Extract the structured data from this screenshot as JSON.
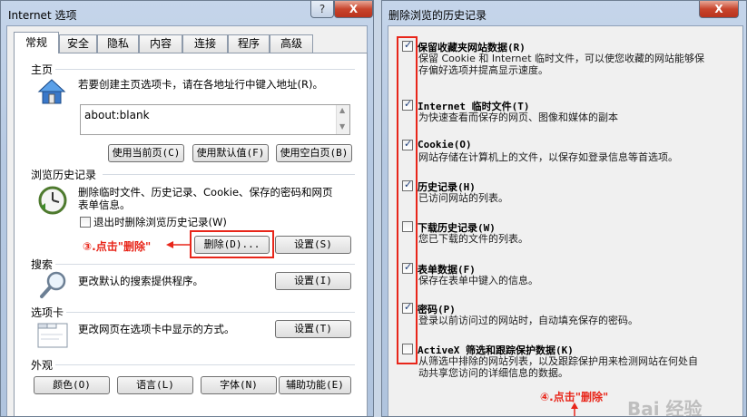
{
  "left_window": {
    "title": "Internet 选项",
    "help_btn": "?",
    "close_btn": "X",
    "tabs": [
      "常规",
      "安全",
      "隐私",
      "内容",
      "连接",
      "程序",
      "高级"
    ],
    "home": {
      "section": "主页",
      "desc": "若要创建主页选项卡，请在各地址行中键入地址(R)。",
      "url": "about:blank",
      "buttons": [
        "使用当前页(C)",
        "使用默认值(F)",
        "使用空白页(B)"
      ]
    },
    "history": {
      "section": "浏览历史记录",
      "desc_line1": "删除临时文件、历史记录、Cookie、保存的密码和网页",
      "desc_line2": "表单信息。",
      "checkbox_label": "退出时删除浏览历史记录(W)",
      "annotation": "③.点击\"删除\"",
      "delete_btn": "删除(D)...",
      "settings_btn": "设置(S)"
    },
    "search": {
      "section": "搜索",
      "desc": "更改默认的搜索提供程序。",
      "settings_btn": "设置(I)"
    },
    "tabsection": {
      "section": "选项卡",
      "desc": "更改网页在选项卡中显示的方式。",
      "settings_btn": "设置(T)"
    },
    "appearance": {
      "section": "外观",
      "buttons": [
        "颜色(O)",
        "语言(L)",
        "字体(N)",
        "辅助功能(E)"
      ]
    }
  },
  "right_window": {
    "title": "删除浏览的历史记录",
    "close_btn": "X",
    "items": [
      {
        "title": "保留收藏夹网站数据(R)",
        "desc1": "保留 Cookie 和 Internet 临时文件，可以使您收藏的网站能够保",
        "desc2": "存偏好选项并提高显示速度。",
        "checked": true
      },
      {
        "title": "Internet 临时文件(T)",
        "desc1": "为快速查看而保存的网页、图像和媒体的副本",
        "desc2": "",
        "checked": true
      },
      {
        "title": "Cookie(O)",
        "desc1": "网站存储在计算机上的文件，以保存如登录信息等首选项。",
        "desc2": "",
        "checked": true
      },
      {
        "title": "历史记录(H)",
        "desc1": "已访问网站的列表。",
        "desc2": "",
        "checked": true
      },
      {
        "title": "下载历史记录(W)",
        "desc1": "您已下载的文件的列表。",
        "desc2": "",
        "checked": false
      },
      {
        "title": "表单数据(F)",
        "desc1": "保存在表单中键入的信息。",
        "desc2": "",
        "checked": true
      },
      {
        "title": "密码(P)",
        "desc1": "登录以前访问过的网站时，自动填充保存的密码。",
        "desc2": "",
        "checked": true
      },
      {
        "title": "ActiveX 筛选和跟踪保护数据(K)",
        "desc1": "从筛选中排除的网站列表，以及跟踪保护用来检测网站在何处自",
        "desc2": "动共享您访问的详细信息的数据。",
        "checked": false
      }
    ],
    "annotation": "④.点击\"删除\"",
    "watermark": "Bai 经验"
  }
}
